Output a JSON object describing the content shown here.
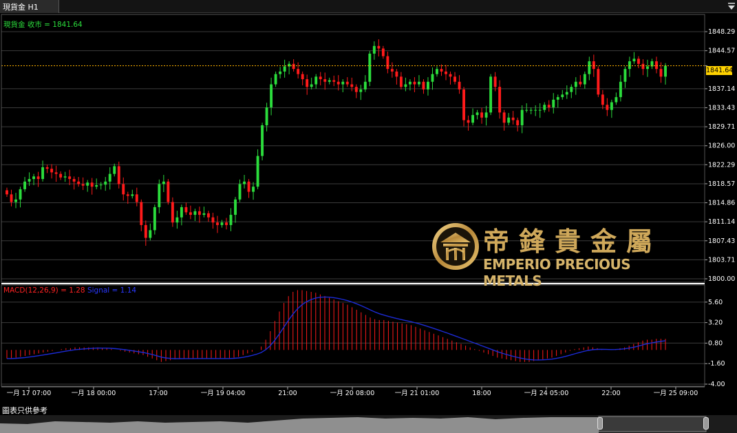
{
  "tab": {
    "title": "現貨金 H1"
  },
  "legend": {
    "main": "現貨金 收市 = 1841.64",
    "macd": "MACD(12,26,9) = 1.28",
    "signal": "Signal = 1.14"
  },
  "current_price": "1841.64",
  "logo": {
    "cn": "帝鋒貴金屬",
    "en": "EMPERIO PRECIOUS METALS"
  },
  "disclaimer": "圖表只供參考",
  "colors": {
    "bull": "#2bdc3c",
    "bear": "#ff1a1a",
    "signal": "#1c2bd6",
    "price_line": "#ffb300",
    "grid": "#3c3c3c"
  },
  "chart_data": [
    {
      "type": "candlestick",
      "yticks": [
        "1848.29",
        "1844.57",
        "1841.64",
        "1837.14",
        "1833.43",
        "1829.71",
        "1826.00",
        "1822.29",
        "1818.57",
        "1814.86",
        "1811.14",
        "1807.43",
        "1803.71",
        "1800.00"
      ],
      "ylim": [
        1800.0,
        1848.29
      ],
      "xticks": [
        "一月 17 07:00",
        "一月 18 00:00",
        "17:00",
        "一月 19 04:00",
        "21:00",
        "一月 20 08:00",
        "一月 21 01:00",
        "18:00",
        "一月 24 05:00",
        "22:00",
        "一月 25 09:00"
      ],
      "close_line": 1841.64,
      "closes": [
        1816.5,
        1815.0,
        1815.5,
        1817.5,
        1819.0,
        1819.5,
        1820.0,
        1819.5,
        1821.8,
        1821.5,
        1820.8,
        1820.5,
        1819.8,
        1820.0,
        1819.5,
        1819.0,
        1818.5,
        1818.2,
        1818.8,
        1818.0,
        1818.3,
        1818.4,
        1819.0,
        1820.5,
        1822.0,
        1818.5,
        1816.5,
        1816.2,
        1816.5,
        1815.0,
        1810.5,
        1808.0,
        1809.5,
        1814.0,
        1818.5,
        1819.0,
        1815.0,
        1811.0,
        1812.0,
        1814.0,
        1813.0,
        1812.5,
        1813.2,
        1812.5,
        1812.8,
        1812.0,
        1811.0,
        1810.5,
        1811.0,
        1810.5,
        1812.5,
        1815.5,
        1818.5,
        1819.0,
        1817.0,
        1818.0,
        1824.0,
        1830.0,
        1833.5,
        1838.0,
        1840.0,
        1840.5,
        1841.5,
        1842.0,
        1841.0,
        1840.0,
        1839.0,
        1837.5,
        1838.0,
        1839.5,
        1839.0,
        1838.5,
        1838.8,
        1838.5,
        1838.0,
        1838.5,
        1838.0,
        1837.5,
        1836.5,
        1837.0,
        1838.5,
        1844.0,
        1845.5,
        1845.0,
        1843.5,
        1841.0,
        1840.5,
        1839.5,
        1837.5,
        1838.0,
        1838.5,
        1838.0,
        1838.5,
        1837.0,
        1838.5,
        1840.0,
        1841.0,
        1840.5,
        1840.0,
        1839.5,
        1838.5,
        1837.0,
        1831.0,
        1830.5,
        1832.0,
        1832.5,
        1831.5,
        1832.5,
        1839.5,
        1837.5,
        1832.5,
        1830.5,
        1831.5,
        1831.0,
        1830.0,
        1833.0,
        1833.0,
        1833.0,
        1833.0,
        1833.0,
        1834.0,
        1833.5,
        1835.0,
        1835.5,
        1836.0,
        1836.5,
        1837.5,
        1838.5,
        1838.0,
        1840.0,
        1842.5,
        1841.0,
        1836.0,
        1834.0,
        1833.0,
        1834.5,
        1835.5,
        1838.5,
        1841.0,
        1842.5,
        1843.0,
        1842.0,
        1841.0,
        1841.5,
        1842.5,
        1841.0,
        1839.5,
        1841.64
      ]
    },
    {
      "type": "bar",
      "name": "MACD(12,26,9)",
      "yticks": [
        "5.60",
        "3.20",
        "0.80",
        "-1.60",
        "-4.00"
      ],
      "ylim": [
        -4.0,
        7.2
      ],
      "histogram": [
        -1.0,
        -1.0,
        -0.9,
        -0.8,
        -0.7,
        -0.6,
        -0.5,
        -0.4,
        -0.3,
        -0.2,
        -0.1,
        0.0,
        0.1,
        0.2,
        0.2,
        0.3,
        0.3,
        0.3,
        0.3,
        0.3,
        0.3,
        0.2,
        0.2,
        0.1,
        0.0,
        -0.1,
        -0.2,
        -0.3,
        -0.4,
        -0.5,
        -0.6,
        -0.8,
        -1.0,
        -1.2,
        -1.4,
        -1.3,
        -1.2,
        -1.1,
        -1.0,
        -1.0,
        -1.0,
        -1.0,
        -1.0,
        -1.0,
        -1.0,
        -1.0,
        -1.0,
        -1.0,
        -1.0,
        -1.0,
        -0.9,
        -0.8,
        -0.6,
        -0.4,
        -0.2,
        0.0,
        0.4,
        1.2,
        2.2,
        3.4,
        4.5,
        5.5,
        6.3,
        6.8,
        7.0,
        7.0,
        6.9,
        6.8,
        6.7,
        6.5,
        6.3,
        6.1,
        5.9,
        5.7,
        5.5,
        5.3,
        5.0,
        4.7,
        4.4,
        4.1,
        3.8,
        3.6,
        3.5,
        3.5,
        3.4,
        3.3,
        3.2,
        3.1,
        3.0,
        2.9,
        2.7,
        2.5,
        2.3,
        2.1,
        1.9,
        1.7,
        1.5,
        1.3,
        1.1,
        0.9,
        0.7,
        0.5,
        0.3,
        0.1,
        -0.1,
        -0.3,
        -0.5,
        -0.7,
        -0.9,
        -1.0,
        -1.1,
        -1.2,
        -1.3,
        -1.4,
        -1.4,
        -1.4,
        -1.3,
        -1.2,
        -1.1,
        -1.0,
        -0.9,
        -0.7,
        -0.5,
        -0.3,
        -0.1,
        0.1,
        0.2,
        0.3,
        0.4,
        0.3,
        0.2,
        0.1,
        0.0,
        0.0,
        0.1,
        0.2,
        0.3,
        0.5,
        0.7,
        0.9,
        1.1,
        1.2,
        1.2,
        1.3,
        1.3,
        1.3
      ]
    }
  ]
}
